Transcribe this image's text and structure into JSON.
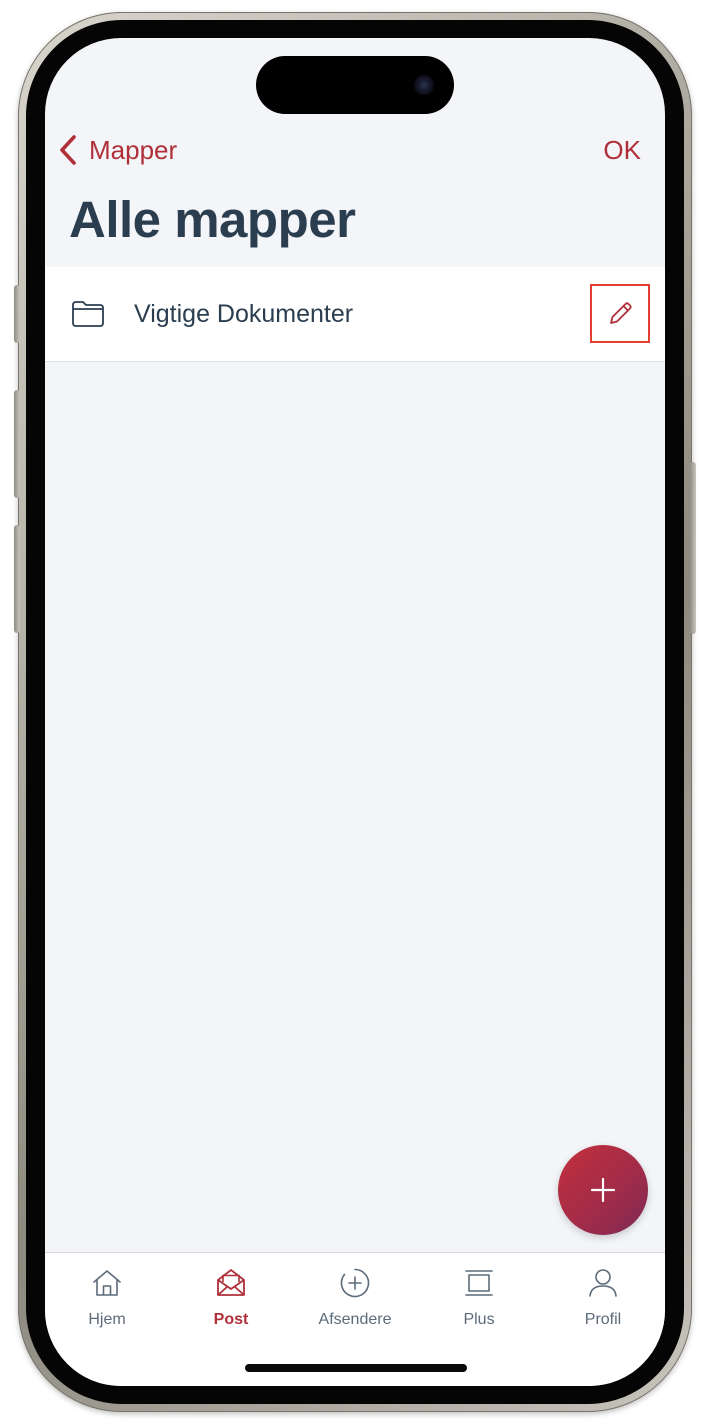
{
  "header": {
    "back_label": "Mapper",
    "ok_label": "OK",
    "title": "Alle mapper"
  },
  "folders": [
    {
      "name": "Vigtige Dokumenter",
      "icon": "folder-icon",
      "action_icon": "pencil-icon"
    }
  ],
  "fab": {
    "icon": "plus-icon"
  },
  "tabs": [
    {
      "label": "Hjem",
      "icon": "house-icon",
      "active": false
    },
    {
      "label": "Post",
      "icon": "envelope-icon",
      "active": true
    },
    {
      "label": "Afsendere",
      "icon": "plus-circle-icon",
      "active": false
    },
    {
      "label": "Plus",
      "icon": "stack-icon",
      "active": false
    },
    {
      "label": "Profil",
      "icon": "person-icon",
      "active": false
    }
  ],
  "colors": {
    "accent": "#b0303a",
    "title_text": "#2b3e50",
    "screen_background": "#f3f5f8",
    "highlight_outline": "#e13f30"
  }
}
